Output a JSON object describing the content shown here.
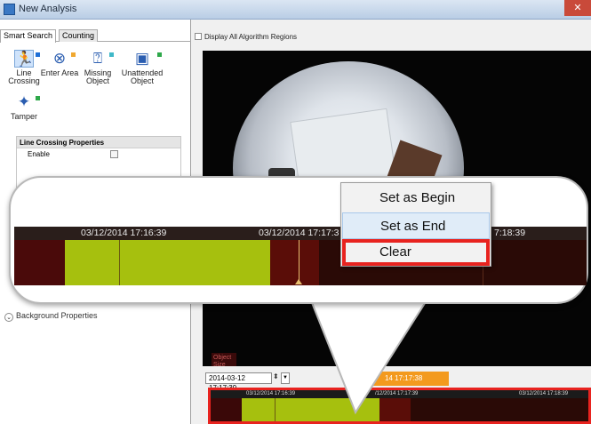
{
  "window": {
    "title": "New Analysis",
    "close_symbol": "✕"
  },
  "tabs": [
    {
      "label": "Smart Search"
    },
    {
      "label": "Counting"
    }
  ],
  "tools": [
    {
      "label": "Line\nCrossing",
      "icon": "line-crossing-icon",
      "mark_color": "#1f6fd6"
    },
    {
      "label": "Enter Area",
      "icon": "enter-area-icon",
      "mark_color": "#f0a830"
    },
    {
      "label": "Missing\nObject",
      "icon": "missing-object-icon",
      "mark_color": "#3fb8c8"
    },
    {
      "label": "Unattended\nObject",
      "icon": "unattended-object-icon",
      "mark_color": "#2ea84a"
    },
    {
      "label": "Tamper",
      "icon": "tamper-icon",
      "mark_color": "#2ea84a"
    }
  ],
  "properties": {
    "header": "Line Crossing Properties",
    "enable_label": "Enable"
  },
  "background_properties": "Background Properties",
  "display_all": "Display All Algorithm Regions",
  "object_size": "Object\nSize",
  "datetime_value": "2014-03-12 17:17:39",
  "orange_time": "14 17:17:38",
  "mini_timeline": {
    "stamps": [
      "03/12/2014 17:16:39",
      "/12/2014 17:17:39",
      "03/12/2014 17:18:39"
    ]
  },
  "zoom_timeline": {
    "stamps": [
      "03/12/2014 17:16:39",
      "03/12/2014 17:17:3",
      "7:18:39"
    ]
  },
  "context_menu": {
    "items": [
      "Set as Begin",
      "Set as End",
      "Clear"
    ]
  },
  "colors": {
    "accent_red": "#e8231f",
    "recorded_green": "#a6c00e",
    "timeline_dark": "#2b0a08",
    "orange": "#f39a1e"
  }
}
